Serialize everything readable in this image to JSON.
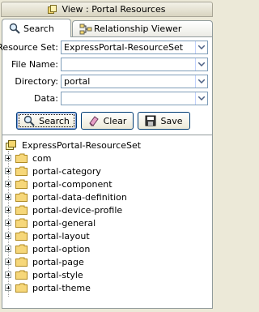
{
  "window": {
    "title": "View : Portal Resources"
  },
  "tabs": [
    {
      "label": "Search",
      "icon": "search-icon",
      "active": true
    },
    {
      "label": "Relationship Viewer",
      "icon": "relationship-icon",
      "active": false
    }
  ],
  "form": {
    "resource_set": {
      "label": "Resource Set:",
      "value": "ExpressPortal-ResourceSet"
    },
    "file_name": {
      "label": "File Name:",
      "value": ""
    },
    "directory": {
      "label": "Directory:",
      "value": "portal"
    },
    "data": {
      "label": "Data:",
      "value": ""
    }
  },
  "buttons": {
    "search": "Search",
    "clear": "Clear",
    "save": "Save"
  },
  "tree": {
    "root": "ExpressPortal-ResourceSet",
    "items": [
      "com",
      "portal-category",
      "portal-component",
      "portal-data-definition",
      "portal-device-profile",
      "portal-general",
      "portal-layout",
      "portal-option",
      "portal-page",
      "portal-style",
      "portal-theme"
    ]
  }
}
